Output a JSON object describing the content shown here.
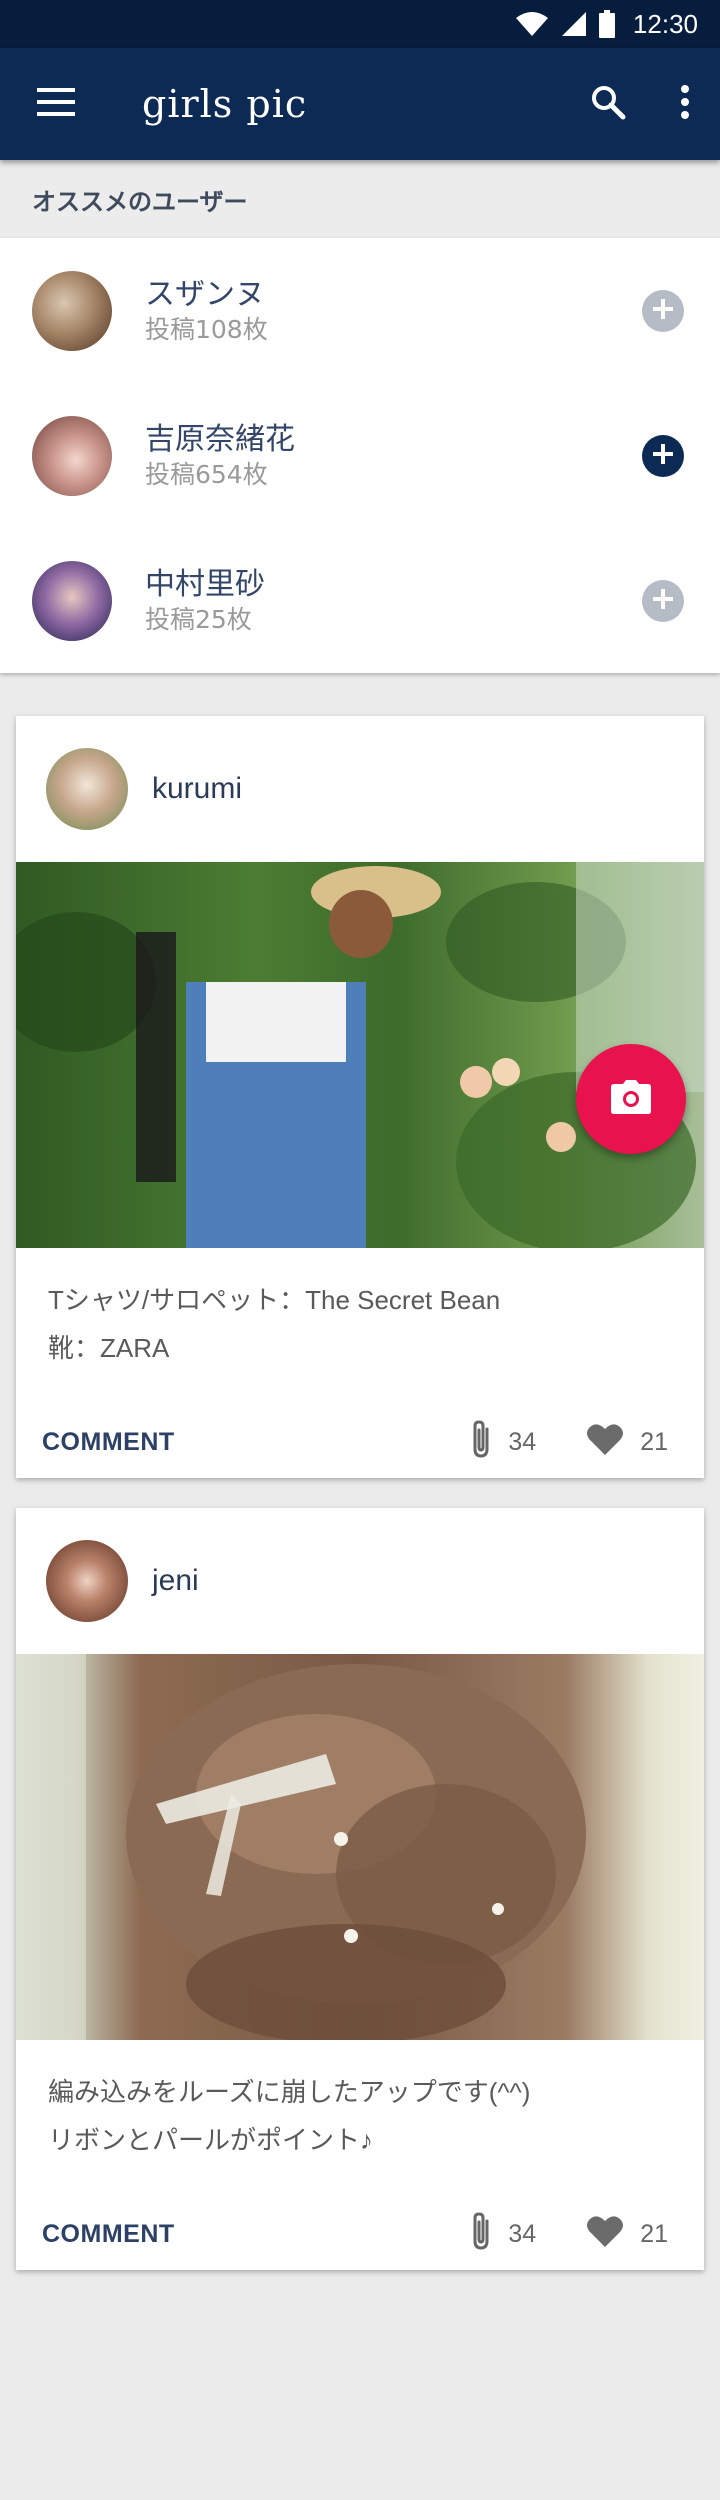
{
  "status_bar": {
    "time": "12:30"
  },
  "app_bar": {
    "title": "girls pic"
  },
  "recommended": {
    "heading": "オススメのユーザー",
    "users": [
      {
        "name": "スザンヌ",
        "posts": "投稿108枚",
        "following": false
      },
      {
        "name": "吉原奈緒花",
        "posts": "投稿654枚",
        "following": true
      },
      {
        "name": "中村里砂",
        "posts": "投稿25枚",
        "following": false
      }
    ]
  },
  "posts": [
    {
      "author": "kurumi",
      "caption_lines": [
        "Tシャツ/サロペット：The Secret Bean",
        "靴：ZARA"
      ],
      "comment_label": "COMMENT",
      "clips": "34",
      "likes": "21"
    },
    {
      "author": "jeni",
      "caption_lines": [
        "編み込みをルーズに崩したアップです(^^)",
        "リボンとパールがポイント♪"
      ],
      "comment_label": "COMMENT",
      "clips": "34",
      "likes": "21"
    }
  ],
  "colors": {
    "primary": "#0c2a54",
    "status_bar": "#071d3e",
    "accent": "#e8124f",
    "follow_inactive": "#b5bcc6"
  },
  "icons": {
    "status": [
      "wifi-icon",
      "signal-icon",
      "battery-icon"
    ],
    "app_bar": [
      "menu-icon",
      "search-icon",
      "more-vert-icon"
    ],
    "post_actions": [
      "paperclip-icon",
      "heart-icon"
    ],
    "fab": "camera-icon"
  }
}
